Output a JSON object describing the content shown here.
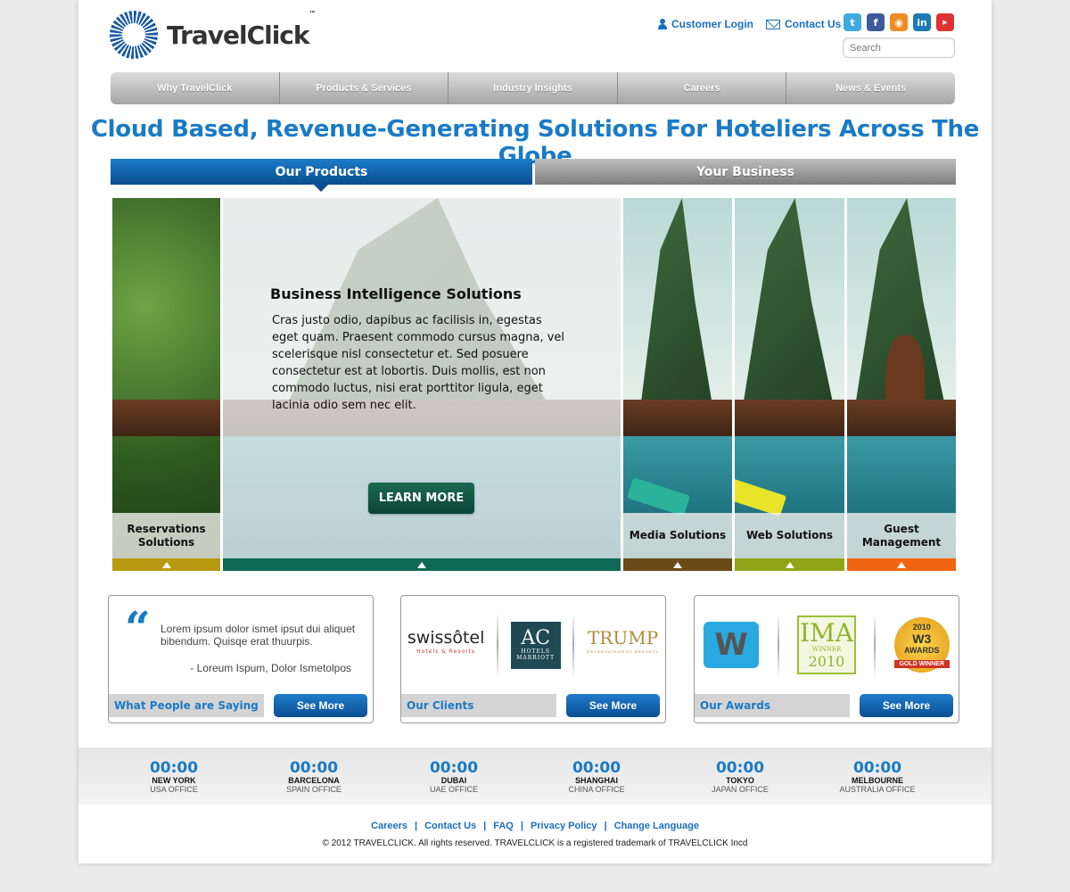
{
  "brand": {
    "name": "TravelClick",
    "tm": "™"
  },
  "header": {
    "customer_login": "Customer Login",
    "contact_us": "Contact Us",
    "search_placeholder": "Search",
    "social": [
      "twitter-icon",
      "facebook-icon",
      "rss-icon",
      "linkedin-icon",
      "youtube-icon"
    ]
  },
  "nav": {
    "items": [
      {
        "label": "Why TravelClick"
      },
      {
        "label": "Products & Services"
      },
      {
        "label": "Industry Insights"
      },
      {
        "label": "Careers"
      },
      {
        "label": "News & Events"
      }
    ]
  },
  "headline": "Cloud Based, Revenue-Generating Solutions For Hoteliers Across The Globe",
  "tabs": {
    "products": "Our Products",
    "business": "Your Business"
  },
  "slider": {
    "feature_title": "Business Intelligence Solutions",
    "feature_body": "Cras justo odio, dapibus ac facilisis in, egestas eget quam. Praesent commodo cursus magna, vel scelerisque nisl consectetur et. Sed posuere consectetur est at lobortis. Duis mollis, est non commodo luctus, nisi erat porttitor ligula, eget lacinia odio sem nec elit.",
    "learn_more": "LEARN MORE",
    "panels": [
      {
        "label": "Reservations Solutions",
        "color": "#b89a10"
      },
      {
        "label": "",
        "color": "#0e6a55"
      },
      {
        "label": "Media Solutions",
        "color": "#6b4a18"
      },
      {
        "label": "Web Solutions",
        "color": "#8fa515"
      },
      {
        "label": "Guest Management",
        "color": "#f16411"
      }
    ]
  },
  "boxes": {
    "testimonial": {
      "quote_mark": "“",
      "text": "Lorem ipsum dolor ismet ipsut dui aliquet bibendum. Quisqe erat thuurpis.",
      "author": "- Loreum Ispum, Dolor Ismetolpos",
      "title": "What People are Saying",
      "see_more": "See More"
    },
    "clients": {
      "title": "Our Clients",
      "see_more": "See More",
      "swissotel": "swissôtel",
      "swissotel_sub": "Hotels & Resorts",
      "ac": "AC",
      "ac_hotels": "HOTELS",
      "ac_marriott": "MARRIOTT",
      "trump": "TRUMP",
      "trump_sub": "ENTERTAINMENT RESORTS"
    },
    "awards": {
      "title": "Our Awards",
      "see_more": "See More",
      "w": "W",
      "ima": "IMA",
      "ima_winner": "WINNER",
      "ima_year": "2010",
      "w3_year": "2010",
      "w3": "W3",
      "w3_awards": "AWARDS",
      "w3_gold": "GOLD WINNER"
    }
  },
  "clocks": [
    {
      "time": "00:00",
      "city": "NEW YORK",
      "office": "USA OFFICE"
    },
    {
      "time": "00:00",
      "city": "BARCELONA",
      "office": "SPAIN OFFICE"
    },
    {
      "time": "00:00",
      "city": "DUBAI",
      "office": "UAE OFFICE"
    },
    {
      "time": "00:00",
      "city": "SHANGHAI",
      "office": "CHINA OFFICE"
    },
    {
      "time": "00:00",
      "city": "TOKYO",
      "office": "JAPAN OFFICE"
    },
    {
      "time": "00:00",
      "city": "MELBOURNE",
      "office": "AUSTRALIA OFFICE"
    }
  ],
  "footer": {
    "links": [
      "Careers",
      "Contact Us",
      "FAQ",
      "Privacy Policy",
      "Change Language"
    ],
    "separator": "|",
    "copyright": "© 2012 TRAVELCLICK. All rights reserved. TRAVELCLICK is a registered trademark of TRAVELCLICK Incd"
  }
}
